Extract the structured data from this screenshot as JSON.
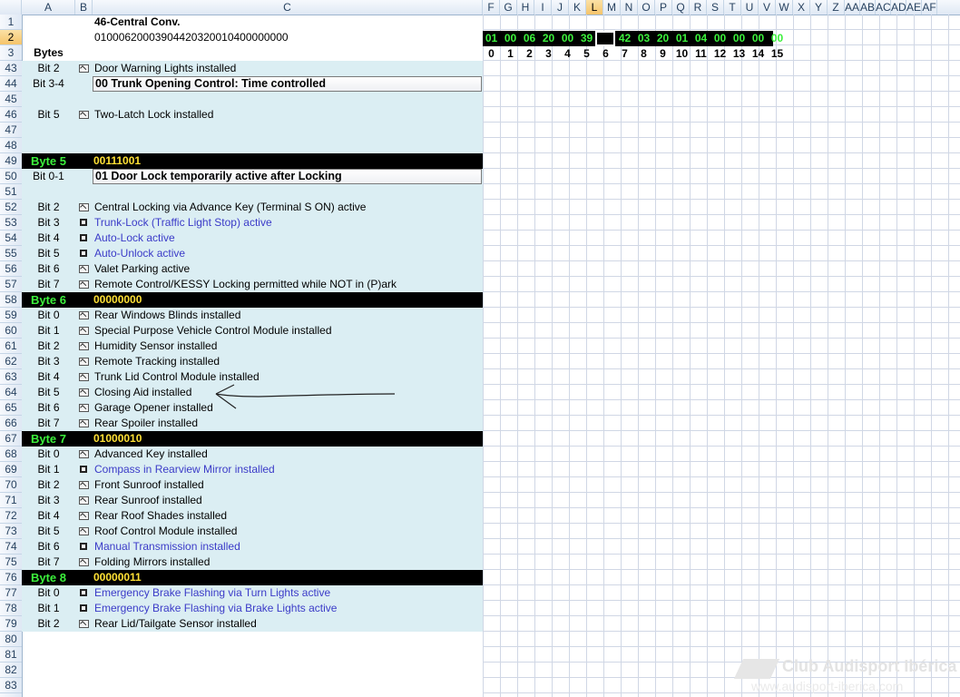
{
  "columns": [
    "A",
    "B",
    "C",
    "F",
    "G",
    "H",
    "I",
    "J",
    "K",
    "L",
    "M",
    "N",
    "O",
    "P",
    "Q",
    "R",
    "S",
    "T",
    "U",
    "V",
    "W",
    "X",
    "Y",
    "Z",
    "AA",
    "AB",
    "AC",
    "AD",
    "AE",
    "AF"
  ],
  "selected_column": "L",
  "selected_row": "2",
  "row_numbers": [
    "1",
    "2",
    "3",
    "43",
    "44",
    "45",
    "46",
    "47",
    "48",
    "49",
    "50",
    "51",
    "52",
    "53",
    "54",
    "55",
    "56",
    "57",
    "58",
    "59",
    "60",
    "61",
    "62",
    "63",
    "64",
    "65",
    "66",
    "67",
    "68",
    "69",
    "70",
    "71",
    "72",
    "73",
    "74",
    "75",
    "76",
    "77",
    "78",
    "79",
    "80",
    "81",
    "82",
    "83"
  ],
  "header": {
    "module_name": "46-Central Conv.",
    "coding_string": "01000620003904420320010400000000",
    "bytes_label": "Bytes"
  },
  "hex_bytes": [
    "01",
    "00",
    "06",
    "20",
    "00",
    "39",
    "",
    "42",
    "03",
    "20",
    "01",
    "04",
    "00",
    "00",
    "00",
    "00"
  ],
  "byte_indices": [
    "0",
    "1",
    "2",
    "3",
    "4",
    "5",
    "6",
    "7",
    "8",
    "9",
    "10",
    "11",
    "12",
    "13",
    "14",
    "15"
  ],
  "rows": [
    {
      "bit": "Bit 2",
      "text": "Door Warning Lights installed",
      "state": "on"
    },
    {
      "bit": "Bit 3-4",
      "dropdown": "00 Trunk Opening Control: Time controlled"
    },
    {
      "bit": "Bit 5",
      "text": "Two-Latch Lock installed",
      "state": "on"
    },
    {
      "byte": "Byte 5",
      "value": "00111001"
    },
    {
      "bit": "Bit 0-1",
      "dropdown": "01 Door Lock temporarily active after Locking"
    },
    {
      "bit": "Bit 2",
      "text": "Central Locking via Advance Key (Terminal S ON) active",
      "state": "on"
    },
    {
      "bit": "Bit 3",
      "text": "Trunk-Lock (Traffic Light Stop) active",
      "state": "off"
    },
    {
      "bit": "Bit 4",
      "text": "Auto-Lock active",
      "state": "off"
    },
    {
      "bit": "Bit 5",
      "text": "Auto-Unlock active",
      "state": "off"
    },
    {
      "bit": "Bit 6",
      "text": "Valet Parking active",
      "state": "on"
    },
    {
      "bit": "Bit 7",
      "text": "Remote Control/KESSY Locking permitted while NOT in (P)ark",
      "state": "on"
    },
    {
      "byte": "Byte 6",
      "value": "00000000"
    },
    {
      "bit": "Bit 0",
      "text": "Rear Windows Blinds installed",
      "state": "on"
    },
    {
      "bit": "Bit 1",
      "text": "Special Purpose Vehicle Control Module installed",
      "state": "on"
    },
    {
      "bit": "Bit 2",
      "text": "Humidity Sensor installed",
      "state": "on"
    },
    {
      "bit": "Bit 3",
      "text": "Remote Tracking installed",
      "state": "on"
    },
    {
      "bit": "Bit 4",
      "text": "Trunk Lid Control Module installed",
      "state": "on"
    },
    {
      "bit": "Bit 5",
      "text": "Closing Aid installed",
      "state": "on"
    },
    {
      "bit": "Bit 6",
      "text": "Garage Opener installed",
      "state": "on"
    },
    {
      "bit": "Bit 7",
      "text": "Rear Spoiler installed",
      "state": "on"
    },
    {
      "byte": "Byte 7",
      "value": "01000010"
    },
    {
      "bit": "Bit 0",
      "text": "Advanced Key installed",
      "state": "on"
    },
    {
      "bit": "Bit 1",
      "text": "Compass in Rearview Mirror installed",
      "state": "off"
    },
    {
      "bit": "Bit 2",
      "text": "Front Sunroof installed",
      "state": "on"
    },
    {
      "bit": "Bit 3",
      "text": "Rear Sunroof installed",
      "state": "on"
    },
    {
      "bit": "Bit 4",
      "text": "Rear Roof Shades installed",
      "state": "on"
    },
    {
      "bit": "Bit 5",
      "text": "Roof Control Module installed",
      "state": "on"
    },
    {
      "bit": "Bit 6",
      "text": "Manual Transmission installed",
      "state": "off"
    },
    {
      "bit": "Bit 7",
      "text": "Folding Mirrors installed",
      "state": "on"
    },
    {
      "byte": "Byte 8",
      "value": "00000011"
    },
    {
      "bit": "Bit 0",
      "text": "Emergency Brake Flashing via Turn Lights active",
      "state": "off"
    },
    {
      "bit": "Bit 1",
      "text": "Emergency Brake Flashing via Brake Lights active",
      "state": "off"
    },
    {
      "bit": "Bit 2",
      "text": "Rear Lid/Tailgate Sensor installed",
      "state": "on"
    }
  ],
  "watermark": {
    "name": "Club Audisport Ibérica",
    "url": "www.audisport-iberica.com"
  },
  "colors": {
    "byte_label": "#3cf03c",
    "byte_value": "#ffe135",
    "unchecked_text": "#3b3bc8",
    "list_bg": "#dbeef3"
  }
}
